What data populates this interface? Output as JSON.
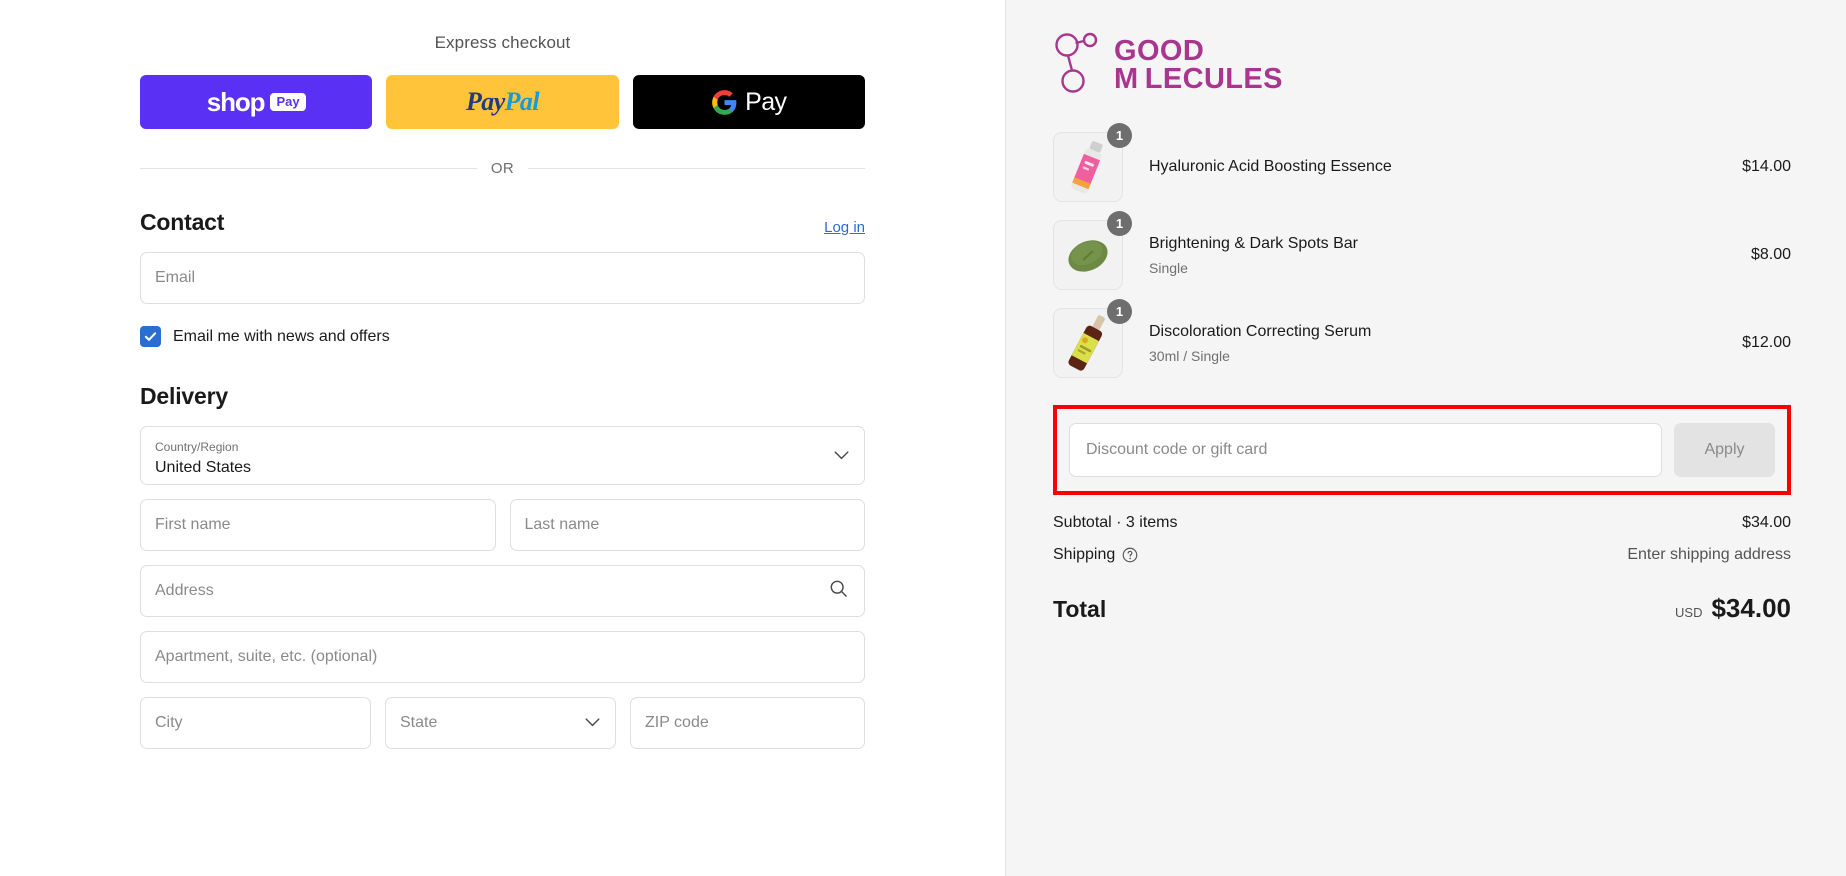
{
  "express": {
    "title": "Express checkout",
    "buttons": [
      {
        "name": "shop-pay",
        "word": "shop",
        "pill": "Pay"
      },
      {
        "name": "paypal",
        "word_a": "Pay",
        "word_b": "Pal"
      },
      {
        "name": "google-pay",
        "word": "Pay"
      }
    ],
    "divider_text": "OR"
  },
  "contact": {
    "title": "Contact",
    "login_label": "Log in",
    "email_placeholder": "Email",
    "newsletter_label": "Email me with news and offers",
    "newsletter_checked": true
  },
  "delivery": {
    "title": "Delivery",
    "country_label": "Country/Region",
    "country_value": "United States",
    "first_name_placeholder": "First name",
    "last_name_placeholder": "Last name",
    "address_placeholder": "Address",
    "apartment_placeholder": "Apartment, suite, etc. (optional)",
    "city_placeholder": "City",
    "state_placeholder": "State",
    "zip_placeholder": "ZIP code"
  },
  "summary": {
    "brand_line1": "GOOD",
    "brand_line2": "M LECULES",
    "brand_color": "#a8368f",
    "items": [
      {
        "name": "Hyaluronic Acid Boosting Essence",
        "variant": "",
        "qty": "1",
        "price": "$14.00"
      },
      {
        "name": "Brightening & Dark Spots Bar",
        "variant": "Single",
        "qty": "1",
        "price": "$8.00"
      },
      {
        "name": "Discoloration Correcting Serum",
        "variant": "30ml / Single",
        "qty": "1",
        "price": "$12.00"
      }
    ],
    "discount_placeholder": "Discount code or gift card",
    "discount_value": "",
    "apply_label": "Apply",
    "highlight_color": "#fa0000",
    "subtotal_label": "Subtotal · 3 items",
    "subtotal_value": "$34.00",
    "shipping_label": "Shipping",
    "shipping_value": "Enter shipping address",
    "total_label": "Total",
    "total_currency": "USD",
    "total_value": "$34.00"
  }
}
